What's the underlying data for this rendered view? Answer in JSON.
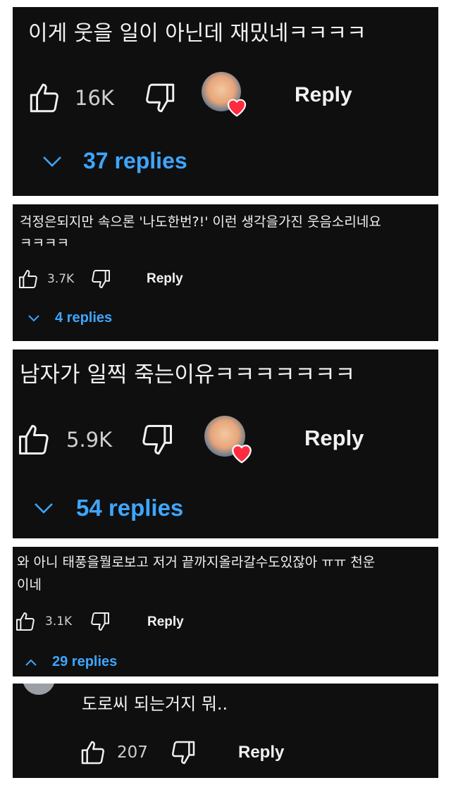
{
  "comments": [
    {
      "text": "이게 웃을 일이 아닌데 재밌네ㅋㅋㅋㅋ",
      "likes": "16K",
      "reply_label": "Reply",
      "replies_label": "37 replies",
      "creator_heart": true,
      "replies_expanded": false
    },
    {
      "text": "걱정은되지만 속으론 '나도한번?!' 이런 생각을가진 웃음소리네요\nㅋㅋㅋㅋ",
      "likes": "3.7K",
      "reply_label": "Reply",
      "replies_label": "4 replies",
      "creator_heart": false,
      "replies_expanded": false
    },
    {
      "text": "남자가 일찍 죽는이유ㅋㅋㅋㅋㅋㅋㅋ",
      "likes": "5.9K",
      "reply_label": "Reply",
      "replies_label": "54 replies",
      "creator_heart": true,
      "replies_expanded": false
    },
    {
      "text": "와 아니 태풍을뭘로보고 저거 끝까지올라갈수도있잖아 ㅠㅠ 천운\n이네",
      "likes": "3.1K",
      "reply_label": "Reply",
      "replies_label": "29 replies",
      "creator_heart": false,
      "replies_expanded": true
    },
    {
      "text": "도로씨 되는거지 뭐..",
      "likes": "207",
      "reply_label": "Reply",
      "creator_heart": false
    }
  ],
  "colors": {
    "card_bg": "#0f0f0f",
    "text": "#f1f1f1",
    "link_blue": "#3ea6ff",
    "heart_red": "#ff2b3f"
  },
  "icons": [
    "thumbs-up-icon",
    "thumbs-down-icon",
    "chevron-down-icon",
    "chevron-up-icon",
    "heart-icon",
    "avatar"
  ]
}
